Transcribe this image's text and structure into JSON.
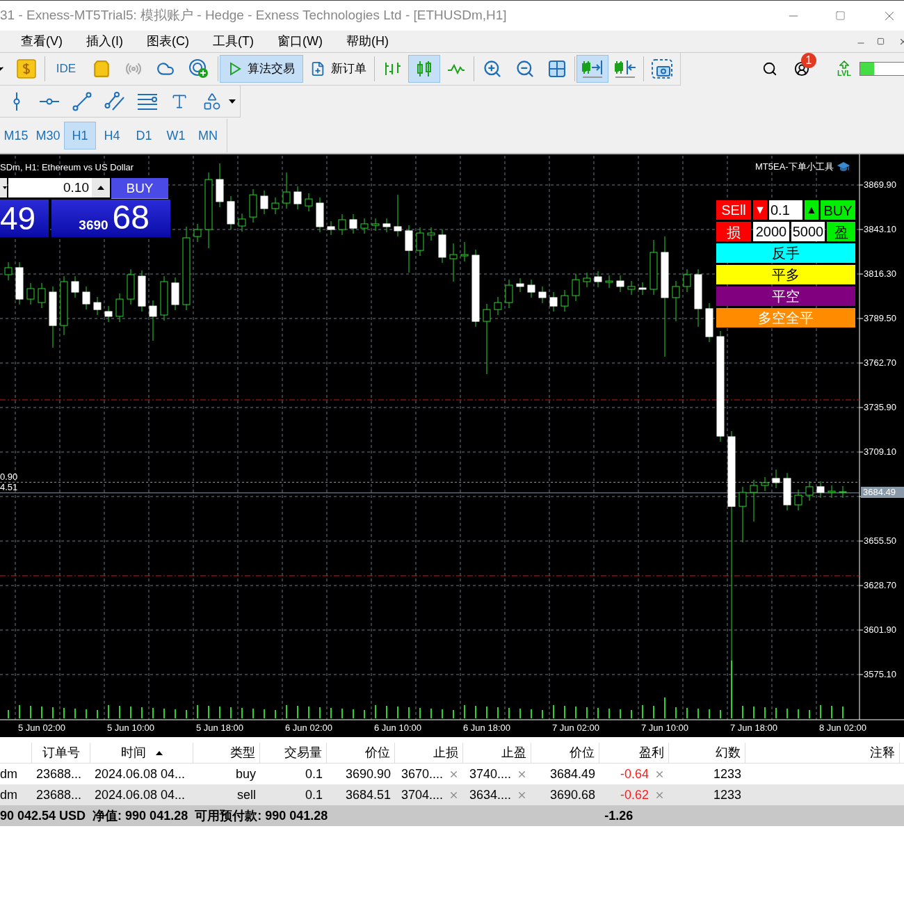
{
  "window": {
    "title": "31 - Exness-MT5Trial5: 模拟账户 - Hedge - Exness Technologies Ltd - [ETHUSDm,H1]"
  },
  "menu": [
    "查看(V)",
    "插入(I)",
    "图表(C)",
    "工具(T)",
    "窗口(W)",
    "帮助(H)"
  ],
  "toolbar": {
    "items": [
      {
        "kind": "icon",
        "selected": false,
        "disabled": false
      },
      {
        "kind": "icon",
        "selected": false,
        "disabled": false
      },
      {
        "kind": "text",
        "label": "IDE",
        "selected": false,
        "disabled": false
      },
      {
        "kind": "icon",
        "selected": false,
        "disabled": false
      },
      {
        "kind": "icon",
        "selected": false,
        "disabled": true
      },
      {
        "kind": "icon",
        "selected": false,
        "disabled": false
      },
      {
        "kind": "icon",
        "selected": false,
        "disabled": false
      },
      {
        "kind": "labeled",
        "label": "算法交易",
        "selected": true,
        "disabled": false
      },
      {
        "kind": "labeled",
        "label": "新订单",
        "selected": false,
        "disabled": false
      },
      {
        "kind": "icon",
        "selected": false,
        "disabled": false
      },
      {
        "kind": "icon",
        "selected": true,
        "disabled": false
      },
      {
        "kind": "icon",
        "selected": false,
        "disabled": false
      },
      {
        "kind": "icon",
        "selected": false,
        "disabled": false
      },
      {
        "kind": "icon",
        "selected": false,
        "disabled": false
      },
      {
        "kind": "icon",
        "selected": false,
        "disabled": false
      },
      {
        "kind": "icon",
        "selected": true,
        "disabled": false
      },
      {
        "kind": "icon",
        "selected": false,
        "disabled": false
      },
      {
        "kind": "icon",
        "selected": false,
        "disabled": false
      }
    ],
    "notification_count": "1",
    "level_label": "LVL",
    "progress": {
      "level": 0.3
    }
  },
  "timeframes": [
    {
      "label": "M15",
      "selected": false
    },
    {
      "label": "M30",
      "selected": false
    },
    {
      "label": "H1",
      "selected": true
    },
    {
      "label": "H4",
      "selected": false
    },
    {
      "label": "D1",
      "selected": false
    },
    {
      "label": "W1",
      "selected": false
    },
    {
      "label": "MN",
      "selected": false
    }
  ],
  "chart": {
    "symbol_title": "SDm, H1:  Ethereum vs US Dollar",
    "one_click": {
      "lot": "0.10",
      "buy_label": "BUY",
      "sell_price_tail": "49",
      "buy_price_head": "3690",
      "buy_price_tail": "68"
    },
    "ea_panel": {
      "title": "MT5EA-下单小工具",
      "sell": "SEll",
      "down": "▼",
      "lot": "0.1",
      "up": "▲",
      "buy": "BUY",
      "stop_label": "损",
      "stop_value": "2000",
      "take_value": "5000",
      "take_label": "盈",
      "actions": [
        {
          "label": "反手",
          "color": "#00ffff"
        },
        {
          "label": "平多",
          "color": "#ffff00"
        },
        {
          "label": "平空",
          "color": "#800080"
        },
        {
          "label": "多空全平",
          "color": "#ff8c00"
        }
      ]
    },
    "line_labels": [
      "0.90",
      "4.51"
    ],
    "current_price": "3684.49",
    "chart_data": {
      "type": "candlestick",
      "categories": [
        null,
        null,
        null,
        "5 Jun 02:00",
        null,
        null,
        null,
        null,
        null,
        null,
        null,
        "5 Jun 10:00",
        null,
        null,
        null,
        null,
        null,
        null,
        null,
        "5 Jun 18:00",
        null,
        null,
        null,
        null,
        null,
        null,
        null,
        "6 Jun 02:00",
        null,
        null,
        null,
        null,
        null,
        null,
        null,
        "6 Jun 10:00",
        null,
        null,
        null,
        null,
        null,
        null,
        null,
        "6 Jun 18:00",
        null,
        null,
        null,
        null,
        null,
        null,
        null,
        "7 Jun 02:00",
        null,
        null,
        null,
        null,
        null,
        null,
        null,
        "7 Jun 10:00",
        null,
        null,
        null,
        null,
        null,
        null,
        null,
        "7 Jun 18:00",
        null,
        null,
        null,
        null,
        null,
        null,
        null,
        "8 Jun 02:00"
      ],
      "ylim": [
        3547.9,
        3887.5
      ],
      "grid": true,
      "ref_lines": [
        {
          "axis": "y",
          "value": 3740.5,
          "color": "#e01010"
        },
        {
          "axis": "y",
          "value": 3634.6,
          "color": "#e01010"
        },
        {
          "axis": "y",
          "value": 3690.9,
          "color": "#2bd42b"
        },
        {
          "axis": "y",
          "value": 3684.49,
          "color": "#8a99aa"
        }
      ],
      "ohlc": [
        [
          3815.9,
          3823.4,
          3812.5,
          3820.1
        ],
        [
          3820.1,
          3823.4,
          3797.9,
          3801.2
        ],
        [
          3801.2,
          3810.9,
          3797.9,
          3807.5
        ],
        [
          3799.1,
          3810.9,
          3795.8,
          3807.5
        ],
        [
          3805.4,
          3808.8,
          3771.9,
          3785.3
        ],
        [
          3785.3,
          3815.0,
          3779.5,
          3811.7
        ],
        [
          3811.7,
          3815.0,
          3802.1,
          3805.4
        ],
        [
          3805.4,
          3808.8,
          3794.9,
          3798.3
        ],
        [
          3799.1,
          3802.5,
          3791.6,
          3794.9
        ],
        [
          3793.7,
          3797.0,
          3787.4,
          3790.8
        ],
        [
          3790.8,
          3804.6,
          3787.4,
          3801.2
        ],
        [
          3801.2,
          3819.2,
          3797.9,
          3815.9
        ],
        [
          3815.0,
          3818.4,
          3793.7,
          3797.0
        ],
        [
          3797.0,
          3800.4,
          3776.1,
          3790.8
        ],
        [
          3791.6,
          3815.0,
          3788.2,
          3811.7
        ],
        [
          3810.9,
          3814.2,
          3794.5,
          3797.9
        ],
        [
          3797.9,
          3844.8,
          3794.5,
          3838.1
        ],
        [
          3838.9,
          3846.5,
          3835.6,
          3843.1
        ],
        [
          3843.1,
          3877.4,
          3831.8,
          3873.2
        ],
        [
          3873.2,
          3882.9,
          3856.5,
          3859.9
        ],
        [
          3859.9,
          3863.2,
          3843.1,
          3846.5
        ],
        [
          3845.2,
          3852.7,
          3841.8,
          3849.4
        ],
        [
          3850.6,
          3867.4,
          3847.3,
          3864.0
        ],
        [
          3863.2,
          3866.6,
          3852.3,
          3855.7
        ],
        [
          3855.7,
          3862.4,
          3852.3,
          3859.0
        ],
        [
          3859.0,
          3877.4,
          3855.7,
          3865.7
        ],
        [
          3865.7,
          3869.1,
          3855.2,
          3858.6
        ],
        [
          3857.3,
          3864.9,
          3854.0,
          3861.5
        ],
        [
          3859.0,
          3862.4,
          3841.4,
          3844.8
        ],
        [
          3844.8,
          3848.1,
          3839.8,
          3843.1
        ],
        [
          3843.1,
          3852.3,
          3839.8,
          3849.0
        ],
        [
          3849.0,
          3852.3,
          3840.6,
          3843.9
        ],
        [
          3843.9,
          3849.8,
          3840.6,
          3846.5
        ],
        [
          3845.6,
          3849.8,
          3842.3,
          3846.5
        ],
        [
          3846.5,
          3849.8,
          3841.4,
          3844.8
        ],
        [
          3844.8,
          3864.0,
          3838.9,
          3842.3
        ],
        [
          3842.3,
          3845.6,
          3817.1,
          3830.5
        ],
        [
          3830.5,
          3844.4,
          3827.2,
          3841.0
        ],
        [
          3839.8,
          3844.4,
          3836.4,
          3841.0
        ],
        [
          3839.8,
          3843.1,
          3823.0,
          3826.4
        ],
        [
          3825.5,
          3834.7,
          3811.7,
          3828.0
        ],
        [
          3827.2,
          3835.6,
          3823.8,
          3828.0
        ],
        [
          3827.6,
          3831.0,
          3784.5,
          3787.8
        ],
        [
          3787.8,
          3798.3,
          3756.0,
          3794.9
        ],
        [
          3794.9,
          3802.5,
          3791.6,
          3799.1
        ],
        [
          3799.1,
          3812.9,
          3795.8,
          3809.6
        ],
        [
          3810.4,
          3813.8,
          3805.4,
          3808.8
        ],
        [
          3809.6,
          3812.9,
          3802.1,
          3805.4
        ],
        [
          3805.4,
          3808.8,
          3798.7,
          3802.1
        ],
        [
          3802.1,
          3805.4,
          3793.7,
          3797.0
        ],
        [
          3797.0,
          3806.7,
          3793.7,
          3803.3
        ],
        [
          3803.3,
          3816.3,
          3800.0,
          3812.9
        ],
        [
          3811.7,
          3817.1,
          3808.3,
          3813.8
        ],
        [
          3814.6,
          3818.0,
          3808.3,
          3811.7
        ],
        [
          3811.3,
          3815.5,
          3807.9,
          3812.1
        ],
        [
          3812.1,
          3815.5,
          3805.4,
          3808.8
        ],
        [
          3807.1,
          3812.1,
          3803.7,
          3808.8
        ],
        [
          3807.9,
          3811.3,
          3803.7,
          3807.1
        ],
        [
          3807.1,
          3836.8,
          3803.7,
          3829.3
        ],
        [
          3829.3,
          3838.9,
          3766.5,
          3802.1
        ],
        [
          3802.1,
          3812.1,
          3787.8,
          3808.8
        ],
        [
          3808.8,
          3819.2,
          3805.4,
          3815.9
        ],
        [
          3815.9,
          3819.2,
          3784.5,
          3795.4
        ],
        [
          3795.4,
          3798.7,
          3775.3,
          3778.6
        ],
        [
          3778.6,
          3782.0,
          3715.4,
          3718.7
        ],
        [
          3718.3,
          3721.7,
          3583.5,
          3676.4
        ],
        [
          3676.4,
          3688.2,
          3654.7,
          3684.8
        ],
        [
          3684.8,
          3692.4,
          3667.2,
          3689.0
        ],
        [
          3689.0,
          3694.0,
          3685.6,
          3690.7
        ],
        [
          3693.2,
          3698.6,
          3687.3,
          3690.7
        ],
        [
          3693.2,
          3696.5,
          3673.9,
          3677.3
        ],
        [
          3677.3,
          3686.5,
          3673.9,
          3683.1
        ],
        [
          3683.1,
          3691.5,
          3679.8,
          3688.2
        ],
        [
          3688.2,
          3691.5,
          3681.5,
          3684.8
        ],
        [
          3684.8,
          3689.0,
          3681.5,
          3685.6
        ],
        [
          3684.8,
          3688.6,
          3681.5,
          3685.2
        ]
      ],
      "yticks": [
        {
          "value": 3869.9,
          "label": "3869.90"
        },
        {
          "value": 3843.1,
          "label": "3843.10"
        },
        {
          "value": 3816.3,
          "label": "3816.30"
        },
        {
          "value": 3789.5,
          "label": "3789.50"
        },
        {
          "value": 3762.7,
          "label": "3762.70"
        },
        {
          "value": 3735.9,
          "label": "3735.90"
        },
        {
          "value": 3709.1,
          "label": "3709.10"
        },
        {
          "value": 3655.5,
          "label": "3655.50"
        },
        {
          "value": 3628.7,
          "label": "3628.70"
        },
        {
          "value": 3601.9,
          "label": "3601.90"
        },
        {
          "value": 3575.1,
          "label": "3575.10"
        }
      ]
    }
  },
  "table": {
    "columns": [
      "",
      "订单号",
      "时间",
      "类型",
      "交易量",
      "价位",
      "止损",
      "止盈",
      "价位",
      "盈利",
      "幻数",
      "注释"
    ],
    "rows": [
      {
        "selected": false,
        "cells": [
          "dm",
          "23688...",
          "2024.06.08 04...",
          "buy",
          "0.1",
          "3690.90",
          "3670....",
          "3740....",
          "3684.49",
          "-0.64",
          "1233"
        ]
      },
      {
        "selected": true,
        "cells": [
          "dm",
          "23688...",
          "2024.06.08 04...",
          "sell",
          "0.1",
          "3684.51",
          "3704....",
          "3634....",
          "3690.68",
          "-0.62",
          "1233"
        ]
      }
    ],
    "summary": [
      "90 042.54 USD",
      "净值: 990 041.28",
      "可用预付款: 990 041.28"
    ],
    "total_profit": "-1.26"
  }
}
